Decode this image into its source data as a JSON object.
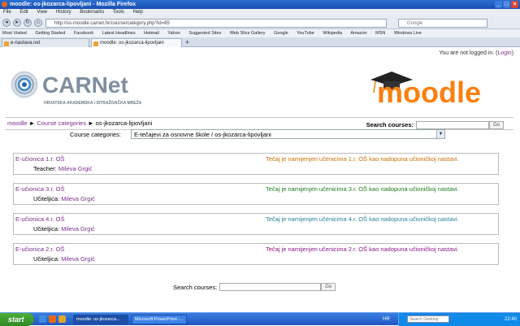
{
  "browser": {
    "window_title": "moodle: os-jkozarca-lipovljani - Mozilla Firefox",
    "menu": [
      "File",
      "Edit",
      "View",
      "History",
      "Bookmarks",
      "Tools",
      "Help"
    ],
    "url": "http://ss-moodle.carnet.hr/course/category.php?id=85",
    "search_placeholder": "Google",
    "bookmarks": [
      "Most Visited",
      "Getting Started",
      "Facebook",
      "Latest Headlines",
      "Hotmail",
      "Yahoo",
      "Suggested Sites",
      "Web Slice Gallery",
      "Google",
      "YouTube",
      "Wikipedia",
      "Amazon",
      "MSN",
      "Windows Live"
    ],
    "tabs": [
      {
        "label": "e-nastava.net",
        "active": false
      },
      {
        "label": "moodle: os-jkozarca-lipovljani",
        "active": true
      }
    ]
  },
  "page": {
    "login_text": "You are not logged in. (",
    "login_link": "Login",
    "login_close": ")",
    "carnet_name": "CARNet",
    "carnet_subtitle": "HRVATSKA AKADEMSKA I ISTRAŽIVAČKA MREŽA",
    "moodle_logo": "moodle",
    "breadcrumb": {
      "home": "moodle",
      "sep1": " ► ",
      "categories": "Course categories",
      "sep2": " ► ",
      "current": "os-jkozarca-lipovljani"
    },
    "search_label": "Search courses:",
    "search_button": "Go",
    "category_label": "Course categories:",
    "category_value": "E-tečajevi za osnovne škole / os-jkozarca-lipovljani"
  },
  "courses": [
    {
      "name": "E-učionica 1.r. OŠ",
      "role": "Teacher:",
      "teacher": "Mileva Grgić",
      "desc": "Tečaj je namijenjen učenicima 1.r. OŠ kao nadopuna učioničkoj nastavi.",
      "desc_color": "#c86f00"
    },
    {
      "name": "E-učionica 3.r. OŠ",
      "role": "Učiteljica:",
      "teacher": "Mileva Grgić",
      "desc": "Tečaj je namijenjen učenicima 3.r. OŠ kao nadopuna učioničkoj nastavi.",
      "desc_color": "#1f7a1f"
    },
    {
      "name": "E-učionica 4.r. OŠ",
      "role": "Učiteljica:",
      "teacher": "Mileva Grgić",
      "desc": "Tečaj je namijenjen učenicima 4.r. OŠ kao nadopuna učioničkoj nastavi.",
      "desc_color": "#2a7f9a"
    },
    {
      "name": "E-učionica 2.r. OŠ",
      "role": "Učiteljica:",
      "teacher": "Mileva Grgić",
      "desc": "Tečaj je namijenjen učenicima 2.r. OŠ kao nadopuna učioničkoj nastavi.",
      "desc_color": "#8a1a8a"
    }
  ],
  "taskbar": {
    "start": "start",
    "items": [
      "moodle: os-jkozarca...",
      "Microsoft PowerPoint -..."
    ],
    "lang": "HR",
    "search_placeholder": "Search Desktop",
    "clock": "22:40"
  }
}
